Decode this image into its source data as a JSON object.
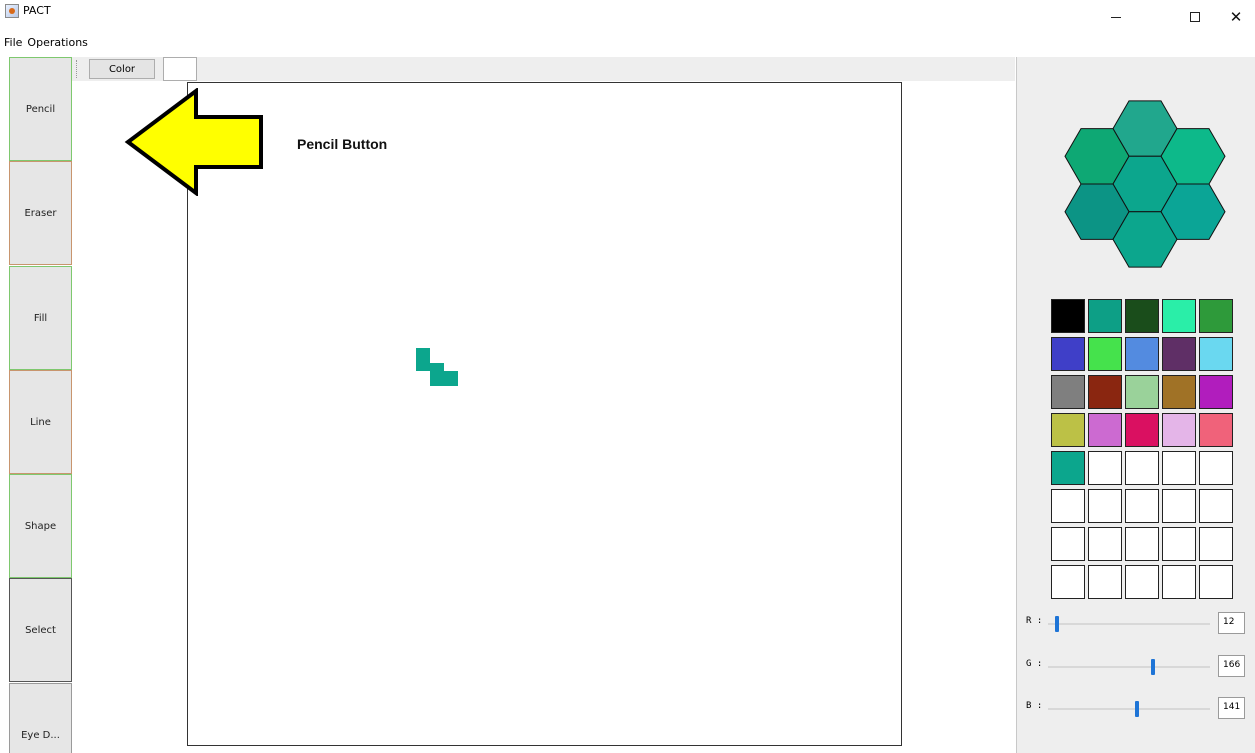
{
  "window": {
    "title": "PACT",
    "minimize": "─",
    "maximize": "☐",
    "close": "✕"
  },
  "menu": [
    "File",
    "Operations"
  ],
  "tools": [
    {
      "label": "Pencil",
      "name": "pencil"
    },
    {
      "label": "Eraser",
      "name": "eraser"
    },
    {
      "label": "Fill",
      "name": "fill"
    },
    {
      "label": "Line",
      "name": "line"
    },
    {
      "label": "Shape",
      "name": "shape"
    },
    {
      "label": "Select",
      "name": "select"
    },
    {
      "label": "Eye D...",
      "name": "eye-dropper"
    }
  ],
  "toolbar": {
    "color_label": "Color",
    "current_color": "#ffffff"
  },
  "annotation": {
    "text": "Pencil Button",
    "arrow_color": "#ffff00"
  },
  "hexagons": [
    "#21a78d",
    "#0ea874",
    "#0db98a",
    "#0ca68d",
    "#0c9485",
    "#0ba596",
    "#0ca68d"
  ],
  "palette": [
    "#000000",
    "#0d9f86",
    "#1a4d1b",
    "#2aeea8",
    "#2e9a3a",
    "#3f3fc8",
    "#45e24c",
    "#538be0",
    "#5f2f66",
    "#6ad8f0",
    "#7f7f7f",
    "#8a2610",
    "#9ad29a",
    "#a07226",
    "#b11dbd",
    "#bcc146",
    "#cc6ad1",
    "#da1061",
    "#e4b5e8",
    "#f0627a",
    "#0ca68d",
    "#ffffff",
    "#ffffff",
    "#ffffff",
    "#ffffff",
    "#ffffff",
    "#ffffff",
    "#ffffff",
    "#ffffff",
    "#ffffff",
    "#ffffff",
    "#ffffff",
    "#ffffff",
    "#ffffff",
    "#ffffff",
    "#ffffff",
    "#ffffff",
    "#ffffff",
    "#ffffff",
    "#ffffff"
  ],
  "sliders": [
    {
      "label": "R :",
      "value": "12",
      "level": 12
    },
    {
      "label": "G :",
      "value": "166",
      "level": 166
    },
    {
      "label": "B :",
      "value": "141",
      "level": 141
    }
  ]
}
